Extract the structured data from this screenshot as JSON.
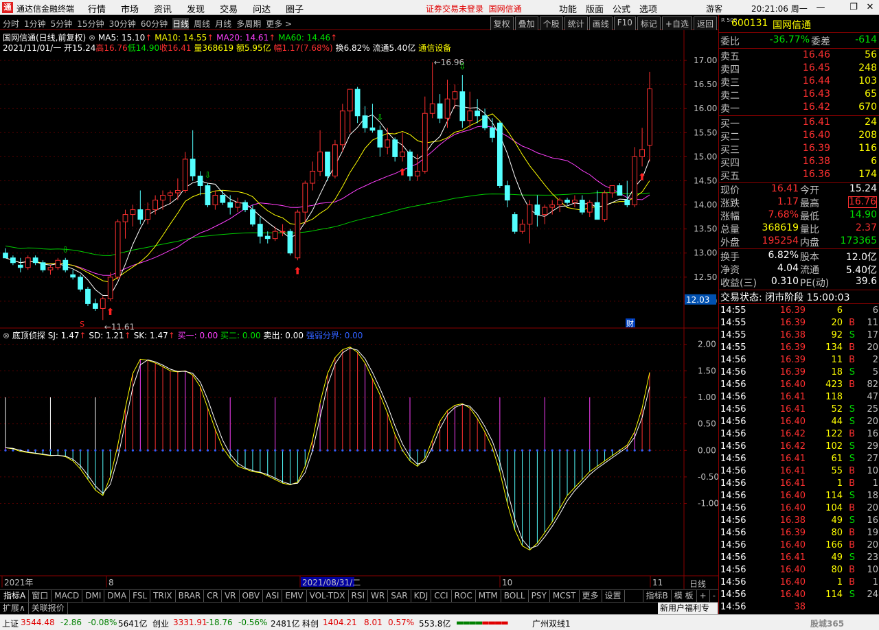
{
  "menubar": {
    "app_title": "通达信金融终端",
    "menus": [
      "行情",
      "市场",
      "资讯",
      "发现",
      "交易",
      "问达",
      "圈子"
    ],
    "notice": "证券交易未登录",
    "notice_stock": "国网信通",
    "right_menus": [
      "功能",
      "版面",
      "公式",
      "选项"
    ],
    "guest": "游客",
    "clock": "20:21:06 周一"
  },
  "periods": {
    "items": [
      "分时",
      "1分钟",
      "5分钟",
      "15分钟",
      "30分钟",
      "60分钟",
      "日线",
      "周线",
      "月线",
      "多周期",
      "更多 >"
    ],
    "active": "日线",
    "tools": [
      "复权",
      "叠加",
      "个股",
      "统计",
      "画线",
      "F10",
      "标记",
      "+自选",
      "返回"
    ]
  },
  "chart": {
    "info": {
      "name": "国网信通(日线,前复权)",
      "ma5": "MA5: 15.10",
      "ma10": "MA10: 14.55",
      "ma20": "MA20: 14.61",
      "ma60": "MA60: 14.46",
      "date": "2021/11/01/一",
      "open": "开15.24",
      "high": "高16.76",
      "low": "低14.90",
      "close": "收16.41",
      "vol": "量368619",
      "amount": "额5.95亿",
      "amp": "幅1.17(7.68%)",
      "turnover": "换6.82%",
      "float": "流通5.40亿",
      "industry": "通信设备"
    },
    "price_labels": [
      "17.00",
      "16.50",
      "16.00",
      "15.50",
      "15.00",
      "14.50",
      "14.00",
      "13.50",
      "13.00",
      "12.50",
      "12.00"
    ],
    "current_price": "12.03",
    "max_label": "16.96",
    "min_label": "11.61",
    "cai_label": "财",
    "s_label": "S",
    "x_labels": {
      "y2021": "2021年",
      "m8": "8",
      "sel_date": "2021/08/31/二",
      "m10": "10",
      "m11": "11"
    },
    "indicator": {
      "name": "底顶侦探",
      "sj": "SJ: 1.47",
      "sd": "SD: 1.21",
      "sk": "SK: 1.47",
      "buy1": "买一: 0.00",
      "buy2": "买二: 0.00",
      "sell": "卖出: 0.00",
      "strong": "强弱分界: 0.00",
      "scale": [
        "2.00",
        "1.50",
        "1.00",
        "0.50",
        "0.00",
        "-0.50",
        "-1.00"
      ]
    },
    "candles": [
      [
        13.0,
        13.1,
        12.9,
        12.9
      ],
      [
        12.9,
        12.95,
        12.75,
        12.8
      ],
      [
        12.75,
        12.9,
        12.6,
        12.7
      ],
      [
        12.7,
        12.95,
        12.65,
        12.9
      ],
      [
        12.9,
        12.95,
        12.75,
        12.8
      ],
      [
        12.8,
        12.85,
        12.6,
        12.65
      ],
      [
        12.65,
        12.75,
        12.55,
        12.7
      ],
      [
        12.7,
        12.9,
        12.65,
        12.85
      ],
      [
        12.85,
        12.9,
        12.6,
        12.65
      ],
      [
        12.55,
        12.65,
        12.45,
        12.5
      ],
      [
        12.5,
        12.55,
        12.2,
        12.25
      ],
      [
        12.25,
        12.3,
        11.9,
        11.95
      ],
      [
        11.95,
        12.05,
        11.8,
        11.85
      ],
      [
        11.85,
        12.1,
        11.61,
        12.05
      ],
      [
        12.05,
        12.6,
        12.0,
        12.5
      ],
      [
        12.5,
        13.7,
        12.45,
        13.65
      ],
      [
        13.65,
        13.9,
        13.3,
        13.8
      ],
      [
        13.8,
        14.0,
        13.55,
        13.9
      ],
      [
        13.9,
        14.3,
        13.6,
        13.7
      ],
      [
        13.7,
        14.05,
        13.6,
        13.9
      ],
      [
        13.9,
        14.2,
        13.8,
        14.1
      ],
      [
        14.1,
        14.3,
        13.9,
        14.2
      ],
      [
        14.2,
        14.3,
        14.05,
        14.25
      ],
      [
        14.25,
        14.55,
        14.1,
        14.3
      ],
      [
        14.3,
        15.1,
        14.25,
        14.95
      ],
      [
        14.95,
        15.55,
        14.5,
        14.6
      ],
      [
        14.6,
        14.7,
        14.2,
        14.4
      ],
      [
        14.4,
        14.45,
        13.95,
        14.0
      ],
      [
        14.0,
        14.3,
        13.9,
        14.2
      ],
      [
        14.2,
        14.3,
        14.0,
        14.05
      ],
      [
        14.05,
        14.2,
        13.8,
        13.95
      ],
      [
        13.95,
        14.15,
        13.85,
        14.05
      ],
      [
        14.05,
        14.1,
        13.85,
        13.9
      ],
      [
        13.9,
        14.0,
        13.55,
        13.6
      ],
      [
        13.6,
        13.75,
        13.2,
        13.35
      ],
      [
        13.35,
        13.45,
        13.2,
        13.3
      ],
      [
        13.3,
        13.55,
        13.25,
        13.45
      ],
      [
        13.45,
        13.6,
        13.35,
        13.45
      ],
      [
        13.45,
        13.5,
        12.95,
        13.0
      ],
      [
        12.9,
        13.9,
        12.85,
        13.85
      ],
      [
        13.85,
        14.5,
        13.6,
        14.45
      ],
      [
        14.45,
        14.9,
        14.3,
        14.7
      ],
      [
        14.7,
        15.55,
        14.6,
        15.1
      ],
      [
        15.1,
        14.6,
        14.5,
        14.6
      ],
      [
        14.6,
        15.35,
        14.55,
        15.25
      ],
      [
        15.25,
        16.1,
        15.1,
        15.95
      ],
      [
        15.95,
        16.4,
        15.5,
        16.4
      ],
      [
        16.4,
        16.45,
        15.7,
        15.85
      ],
      [
        15.85,
        16.05,
        15.5,
        15.6
      ],
      [
        15.6,
        16.1,
        15.5,
        15.55
      ],
      [
        15.55,
        15.65,
        15.0,
        15.2
      ],
      [
        15.2,
        15.6,
        15.05,
        15.35
      ],
      [
        15.35,
        15.4,
        14.9,
        15.0
      ],
      [
        15.0,
        15.5,
        14.9,
        15.1
      ],
      [
        15.1,
        15.15,
        14.5,
        14.6
      ],
      [
        14.6,
        15.05,
        14.5,
        14.7
      ],
      [
        14.7,
        16.25,
        14.65,
        15.9
      ],
      [
        15.9,
        16.96,
        15.8,
        16.1
      ],
      [
        16.1,
        16.3,
        15.7,
        15.8
      ],
      [
        15.8,
        16.6,
        15.6,
        16.2
      ],
      [
        16.2,
        16.5,
        16.0,
        16.35
      ],
      [
        16.35,
        16.7,
        15.6,
        15.75
      ],
      [
        15.75,
        16.35,
        15.6,
        15.95
      ],
      [
        15.95,
        16.2,
        15.7,
        15.85
      ],
      [
        15.85,
        16.0,
        15.55,
        15.6
      ],
      [
        15.6,
        15.8,
        15.3,
        15.4
      ],
      [
        15.7,
        15.75,
        14.35,
        14.4
      ],
      [
        14.4,
        14.5,
        13.95,
        14.1
      ],
      [
        13.8,
        13.85,
        13.4,
        13.45
      ],
      [
        13.45,
        13.7,
        13.4,
        13.6
      ],
      [
        13.6,
        14.1,
        13.2,
        14.0
      ],
      [
        14.0,
        14.2,
        13.55,
        13.8
      ],
      [
        13.8,
        14.0,
        13.6,
        13.95
      ],
      [
        13.95,
        14.1,
        13.8,
        14.0
      ],
      [
        14.0,
        14.15,
        13.85,
        14.1
      ],
      [
        14.1,
        14.15,
        14.0,
        14.05
      ],
      [
        14.05,
        14.2,
        13.95,
        14.1
      ],
      [
        14.1,
        14.2,
        13.8,
        13.85
      ],
      [
        13.85,
        14.1,
        13.75,
        14.05
      ],
      [
        14.05,
        14.3,
        13.7,
        13.7
      ],
      [
        13.7,
        14.3,
        13.65,
        14.25
      ],
      [
        14.25,
        14.4,
        14.15,
        14.4
      ],
      [
        14.4,
        14.45,
        14.2,
        14.2
      ],
      [
        14.1,
        14.5,
        13.95,
        14.0
      ],
      [
        14.0,
        15.2,
        13.95,
        15.0
      ],
      [
        15.0,
        15.6,
        14.8,
        15.15
      ],
      [
        15.24,
        16.76,
        14.9,
        16.41
      ]
    ],
    "ind_values": [
      0.05,
      0.03,
      -0.02,
      -0.04,
      -0.06,
      -0.08,
      -0.1,
      -0.09,
      -0.12,
      -0.2,
      -0.35,
      -0.55,
      -0.75,
      -0.85,
      -0.5,
      0.1,
      0.8,
      1.45,
      1.72,
      1.7,
      1.65,
      1.58,
      1.5,
      1.48,
      1.5,
      1.42,
      1.2,
      0.8,
      0.4,
      0.05,
      -0.15,
      -0.3,
      -0.35,
      -0.4,
      -0.42,
      -0.48,
      -0.55,
      -0.62,
      -0.65,
      -0.6,
      -0.3,
      0.2,
      0.9,
      1.45,
      1.75,
      1.9,
      1.95,
      1.85,
      1.65,
      1.35,
      1.05,
      0.7,
      0.3,
      0.0,
      -0.2,
      -0.3,
      -0.15,
      0.2,
      0.55,
      0.75,
      0.85,
      0.88,
      0.8,
      0.6,
      0.35,
      0.05,
      -0.4,
      -1.0,
      -1.5,
      -1.8,
      -1.88,
      -1.75,
      -1.55,
      -1.35,
      -1.1,
      -0.85,
      -0.7,
      -0.55,
      -0.4,
      -0.3,
      -0.2,
      -0.1,
      0.0,
      0.1,
      0.35,
      0.8,
      1.47
    ]
  },
  "tabs": {
    "items": [
      "指标A",
      "窗口",
      "MACD",
      "DMI",
      "DMA",
      "FSL",
      "TRIX",
      "BRAR",
      "CR",
      "VR",
      "OBV",
      "ASI",
      "EMV",
      "VOL-TDX",
      "RSI",
      "WR",
      "SAR",
      "KDJ",
      "CCI",
      "ROC",
      "MTM",
      "BOLL",
      "PSY",
      "MCST",
      "更多",
      "设置"
    ],
    "right": [
      "指标B",
      "模 板",
      "+",
      "-"
    ],
    "right_top": "日线",
    "ext": [
      "扩展∧",
      "关联报价"
    ],
    "promo": "新用户福利专享"
  },
  "status": {
    "sh_name": "上证",
    "sh_val": "3544.48",
    "sh_chg": "-2.86",
    "sh_pct": "-0.08%",
    "sh_amt": "5641亿",
    "cy_name": "创业",
    "cy_val": "3331.91",
    "cy_chg": "-18.76",
    "cy_pct": "-0.56%",
    "cy_amt": "2481亿",
    "kc_name": "科创",
    "kc_val": "1404.21",
    "kc_chg": "8.01",
    "kc_pct": "0.57%",
    "kc_amt": "553.8亿",
    "server": "广州双线1",
    "watermark": "股城365"
  },
  "quote": {
    "market": "R 500",
    "code": "600131",
    "name": "国网信通",
    "wb_label": "委比",
    "wb_val": "-36.77%",
    "wc_label": "委差",
    "wc_val": "-614",
    "sell": [
      {
        "label": "卖五",
        "price": "16.46",
        "vol": "56"
      },
      {
        "label": "卖四",
        "price": "16.45",
        "vol": "248"
      },
      {
        "label": "卖三",
        "price": "16.44",
        "vol": "103"
      },
      {
        "label": "卖二",
        "price": "16.43",
        "vol": "65"
      },
      {
        "label": "卖一",
        "price": "16.42",
        "vol": "670"
      }
    ],
    "buy": [
      {
        "label": "买一",
        "price": "16.41",
        "vol": "24"
      },
      {
        "label": "买二",
        "price": "16.40",
        "vol": "208"
      },
      {
        "label": "买三",
        "price": "16.39",
        "vol": "116"
      },
      {
        "label": "买四",
        "price": "16.38",
        "vol": "6"
      },
      {
        "label": "买五",
        "price": "16.36",
        "vol": "174"
      }
    ],
    "stats": [
      [
        {
          "l": "现价",
          "v": "16.41",
          "c": "r"
        },
        {
          "l": "今开",
          "v": "15.24",
          "c": "w"
        }
      ],
      [
        {
          "l": "涨跌",
          "v": "1.17",
          "c": "r"
        },
        {
          "l": "最高",
          "v": "16.76",
          "c": "r"
        }
      ],
      [
        {
          "l": "涨幅",
          "v": "7.68%",
          "c": "r"
        },
        {
          "l": "最低",
          "v": "14.90",
          "c": "g"
        }
      ],
      [
        {
          "l": "总量",
          "v": "368619",
          "c": "y"
        },
        {
          "l": "量比",
          "v": "2.37",
          "c": "r"
        }
      ],
      [
        {
          "l": "外盘",
          "v": "195254",
          "c": "r"
        },
        {
          "l": "内盘",
          "v": "173365",
          "c": "g"
        }
      ]
    ],
    "stats2": [
      [
        {
          "l": "换手",
          "v": "6.82%",
          "c": "w"
        },
        {
          "l": "股本",
          "v": "12.0亿",
          "c": "w"
        }
      ],
      [
        {
          "l": "净资",
          "v": "4.04",
          "c": "w"
        },
        {
          "l": "流通",
          "v": "5.40亿",
          "c": "w"
        }
      ],
      [
        {
          "l": "收益(三)",
          "v": "0.310",
          "c": "w"
        },
        {
          "l": "PE(动)",
          "v": "39.6",
          "c": "w"
        }
      ]
    ],
    "trade_state": "交易状态: 闭市阶段 15:00:03",
    "ticks": [
      [
        "14:55",
        "16.39",
        "6",
        "",
        "6"
      ],
      [
        "14:55",
        "16.39",
        "20",
        "B",
        "11"
      ],
      [
        "14:55",
        "16.38",
        "92",
        "S",
        "17"
      ],
      [
        "14:55",
        "16.39",
        "134",
        "B",
        "20"
      ],
      [
        "14:56",
        "16.39",
        "11",
        "B",
        "2"
      ],
      [
        "14:56",
        "16.39",
        "18",
        "S",
        "5"
      ],
      [
        "14:56",
        "16.40",
        "423",
        "B",
        "82"
      ],
      [
        "14:56",
        "16.41",
        "118",
        "",
        "47"
      ],
      [
        "14:56",
        "16.41",
        "52",
        "S",
        "25"
      ],
      [
        "14:56",
        "16.40",
        "44",
        "S",
        "20"
      ],
      [
        "14:56",
        "16.42",
        "122",
        "B",
        "16"
      ],
      [
        "14:56",
        "16.42",
        "102",
        "S",
        "29"
      ],
      [
        "14:56",
        "16.41",
        "61",
        "S",
        "27"
      ],
      [
        "14:56",
        "16.41",
        "55",
        "B",
        "10"
      ],
      [
        "14:56",
        "16.41",
        "1",
        "B",
        "1"
      ],
      [
        "14:56",
        "16.40",
        "114",
        "S",
        "18"
      ],
      [
        "14:56",
        "16.40",
        "104",
        "B",
        "20"
      ],
      [
        "14:56",
        "16.38",
        "49",
        "S",
        "16"
      ],
      [
        "14:56",
        "16.39",
        "80",
        "B",
        "19"
      ],
      [
        "14:56",
        "16.40",
        "166",
        "B",
        "20"
      ],
      [
        "14:56",
        "16.41",
        "49",
        "S",
        "23"
      ],
      [
        "14:56",
        "16.40",
        "80",
        "B",
        "10"
      ],
      [
        "14:56",
        "16.40",
        "1",
        "B",
        "1"
      ],
      [
        "14:56",
        "16.40",
        "114",
        "S",
        "24"
      ],
      [
        "14:56",
        "38",
        "",
        "",
        ""
      ]
    ]
  },
  "colors": {
    "up": "#ff3030",
    "down": "#54ffff",
    "ma5": "#ffffff",
    "ma10": "#ffff00",
    "ma20": "#ff40ff",
    "ma60": "#00d000",
    "grid": "#5a0000"
  }
}
